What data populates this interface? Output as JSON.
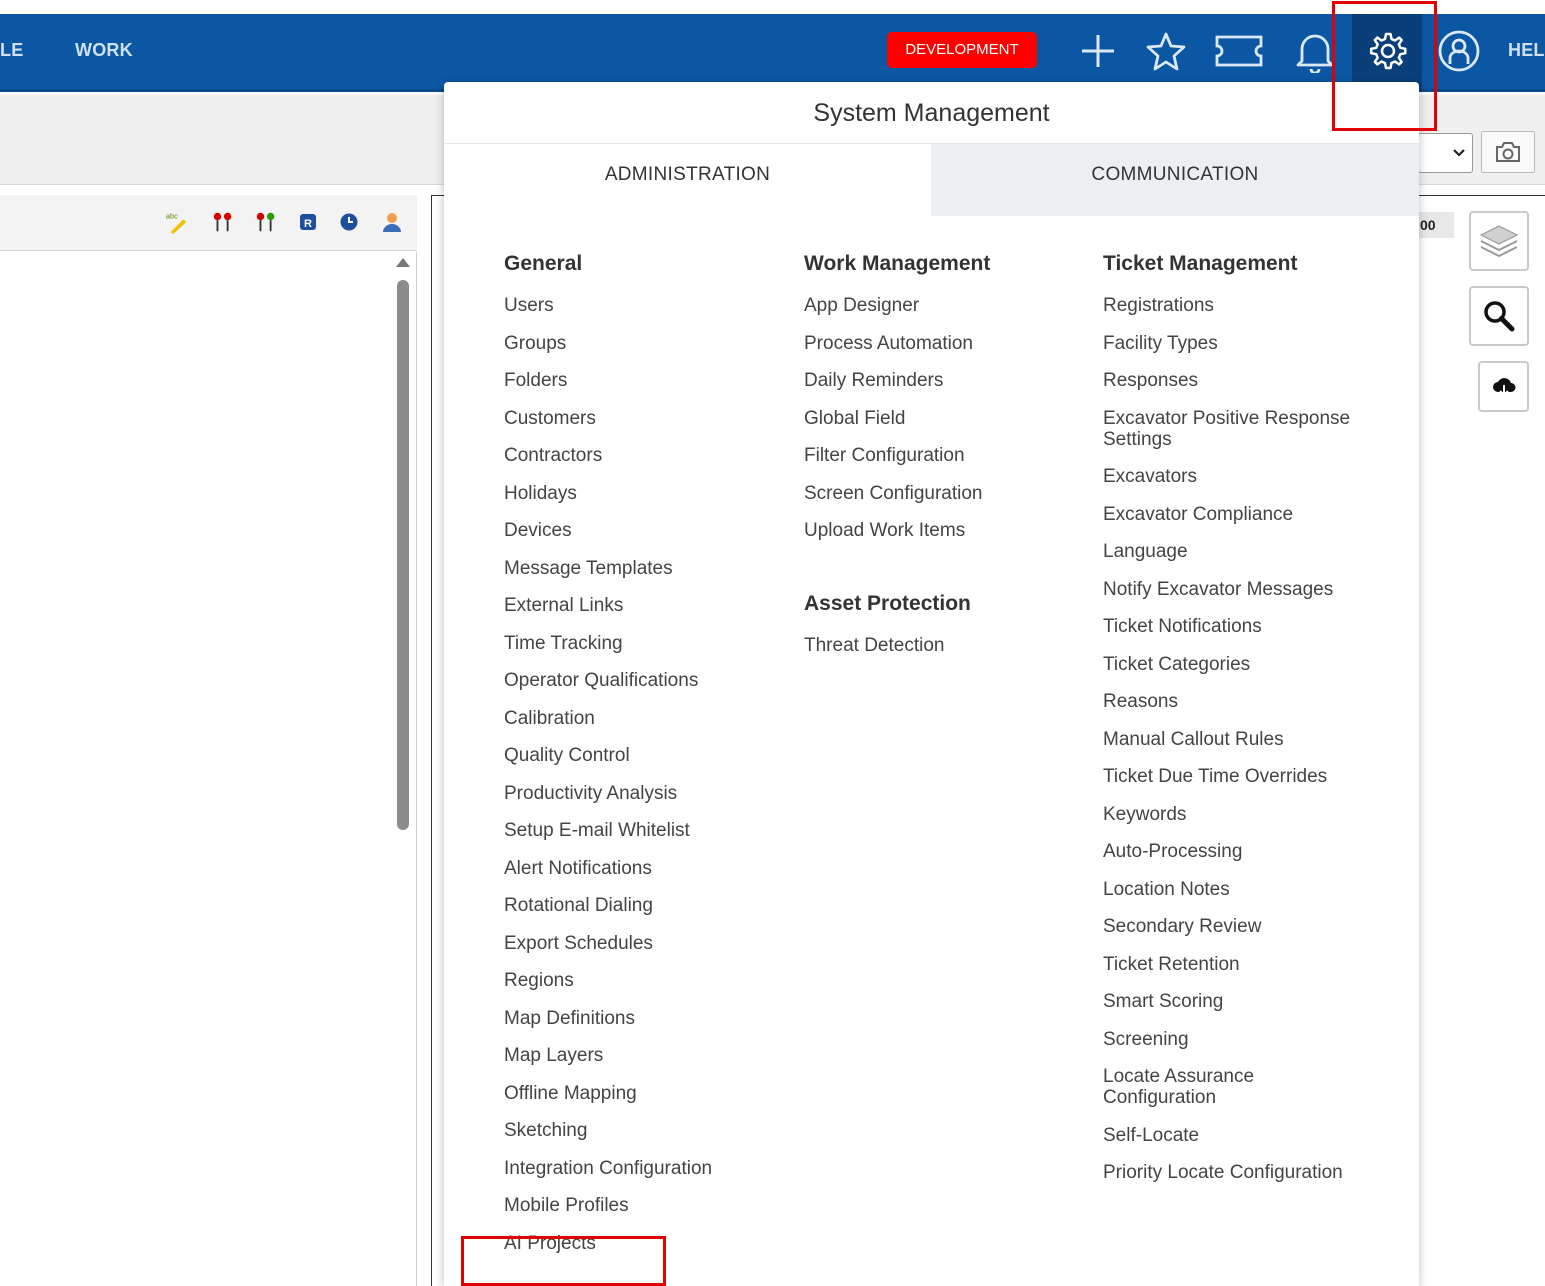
{
  "nav": {
    "items": [
      "LE",
      "WORK",
      "HEL"
    ],
    "dev_badge": "DEVELOPMENT",
    "icons": [
      "plus-icon",
      "star-icon",
      "ticket-icon",
      "bell-icon",
      "gear-icon",
      "user-icon"
    ]
  },
  "map": {
    "coord_text": "00"
  },
  "menu": {
    "title": "System Management",
    "tabs": [
      "ADMINISTRATION",
      "COMMUNICATION"
    ],
    "general": {
      "heading": "General",
      "items": [
        "Users",
        "Groups",
        "Folders",
        "Customers",
        "Contractors",
        "Holidays",
        "Devices",
        "Message Templates",
        "External Links",
        "Time Tracking",
        "Operator Qualifications",
        "Calibration",
        "Quality Control",
        "Productivity Analysis",
        "Setup E-mail Whitelist",
        "Alert Notifications",
        "Rotational Dialing",
        "Export Schedules",
        "Regions",
        "Map Definitions",
        "Map Layers",
        "Offline Mapping",
        "Sketching",
        "Integration Configuration",
        "Mobile Profiles",
        "AI Projects"
      ]
    },
    "work": {
      "heading": "Work Management",
      "items": [
        "App Designer",
        "Process Automation",
        "Daily Reminders",
        "Global Field",
        "Filter Configuration",
        "Screen Configuration",
        "Upload Work Items"
      ]
    },
    "asset": {
      "heading": "Asset Protection",
      "items": [
        "Threat Detection"
      ]
    },
    "ticket": {
      "heading": "Ticket Management",
      "items": [
        "Registrations",
        "Facility Types",
        "Responses",
        "Excavator Positive Response Settings",
        "Excavators",
        "Excavator Compliance",
        "Language",
        "Notify Excavator Messages",
        "Ticket Notifications",
        "Ticket Categories",
        "Reasons",
        "Manual Callout Rules",
        "Ticket Due Time Overrides",
        "Keywords",
        "Auto-Processing",
        "Location Notes",
        "Secondary Review",
        "Ticket Retention",
        "Smart Scoring",
        "Screening",
        "Locate Assurance Configuration",
        "Self-Locate",
        "Priority Locate Configuration"
      ]
    }
  },
  "colors": {
    "nav_bg": "#0b57a4",
    "badge_bg": "#ff0000",
    "annotation": "#e30000"
  }
}
